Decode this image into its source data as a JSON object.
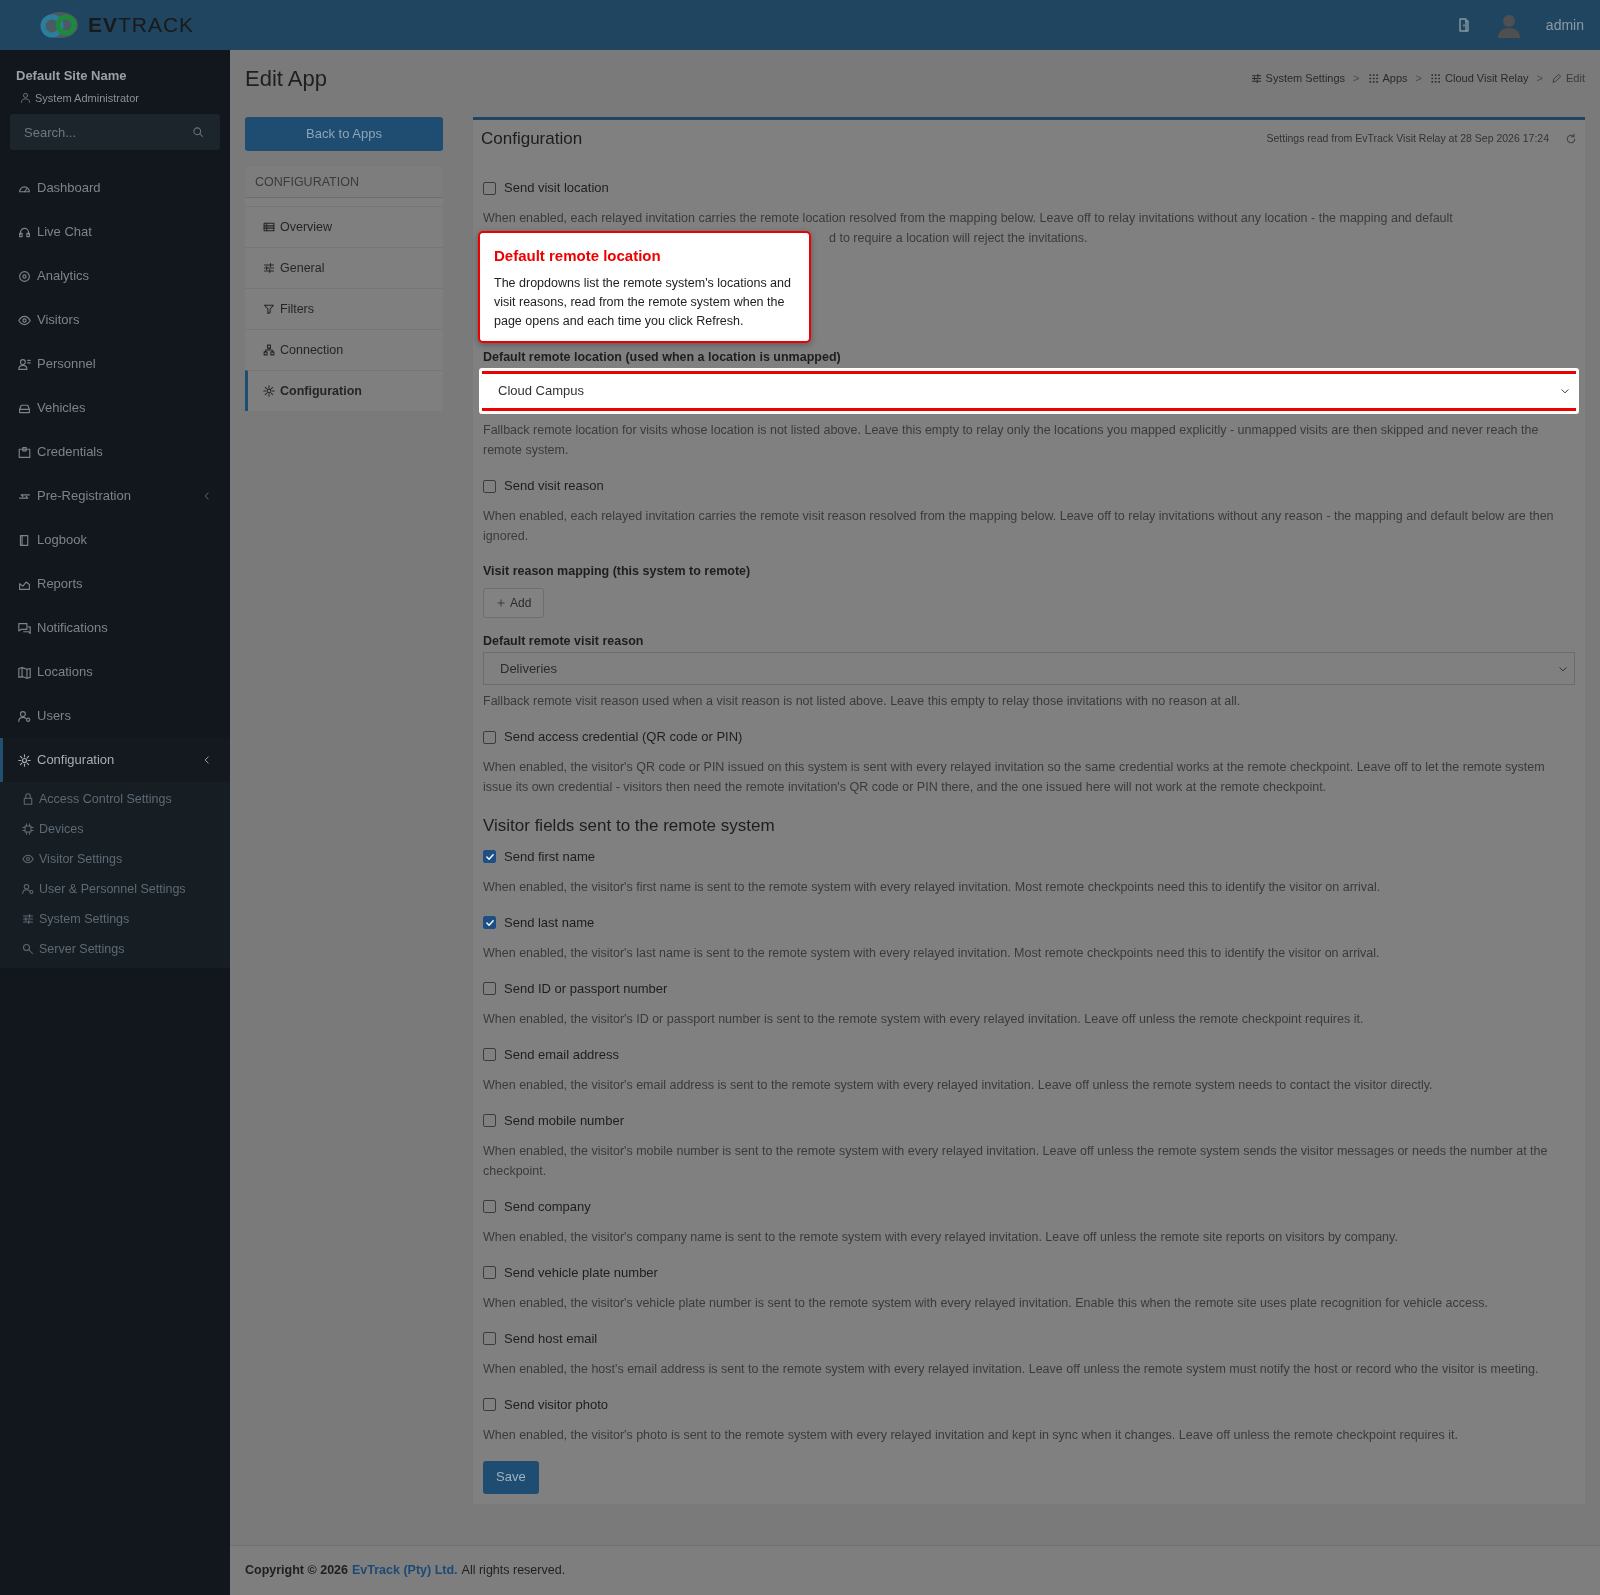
{
  "topbar": {
    "logo": "**EV**TRACK",
    "user": "admin"
  },
  "sidebar": {
    "site_name": "Default Site Name",
    "role": "System Administrator",
    "search": {
      "placeholder": "Search..."
    },
    "items": [
      {
        "label": "Dashboard",
        "selected": false
      },
      {
        "label": "Live Chat",
        "selected": false
      },
      {
        "label": "Analytics",
        "selected": false
      },
      {
        "label": "Visitors",
        "selected": false
      },
      {
        "label": "Personnel",
        "selected": false
      },
      {
        "label": "Vehicles",
        "selected": false
      },
      {
        "label": "Credentials",
        "selected": false
      },
      {
        "label": "Pre-Registration",
        "selected": false,
        "expanded": false
      },
      {
        "label": "Logbook",
        "selected": false
      },
      {
        "label": "Reports",
        "selected": false
      },
      {
        "label": "Notifications",
        "selected": false
      },
      {
        "label": "Locations",
        "selected": false
      },
      {
        "label": "Users",
        "selected": false
      },
      {
        "label": "Configuration",
        "selected": true,
        "expanded": true,
        "children": [
          {
            "label": "Access Control Settings"
          },
          {
            "label": "Devices"
          },
          {
            "label": "Visitor Settings"
          },
          {
            "label": "User & Personnel Settings"
          },
          {
            "label": "System Settings"
          },
          {
            "label": "Server Settings"
          }
        ]
      }
    ]
  },
  "page_title": "Edit App",
  "breadcrumb": [
    {
      "label": "System Settings",
      "separator": ">"
    },
    {
      "label": "Apps",
      "separator": ">"
    },
    {
      "label": "Cloud Visit Relay",
      "separator": ">"
    },
    {
      "label": "Edit"
    }
  ],
  "back_button": "Back to Apps",
  "config_nav": {
    "header": "CONFIGURATION",
    "items": [
      {
        "label": "Overview",
        "selected": false
      },
      {
        "label": "General",
        "selected": false
      },
      {
        "label": "Filters",
        "selected": false
      },
      {
        "label": "Connection",
        "selected": false
      },
      {
        "label": "Configuration",
        "selected": true
      }
    ]
  },
  "card": {
    "title": "Configuration",
    "status": "Settings read from EvTrack Visit Relay at 28 Sep 2026 17:24",
    "fields": [
      {
        "kind": "checkbox",
        "label": "Send visit location",
        "checked": false,
        "description": "When enabled, each relayed invitation carries the remote location resolved from the mapping below. Leave off to relay invitations without any location - the mapping and default",
        "description_tail": "d to require a location will reject the invitations."
      },
      {
        "kind": "select",
        "label": "Default remote location (used when a location is unmapped)",
        "value": "Cloud Campus",
        "highlighted": true,
        "description": "Fallback remote location for visits whose location is not listed above. Leave this empty to relay only the locations you mapped explicitly - unmapped visits are then skipped and never reach the remote system."
      },
      {
        "kind": "checkbox",
        "label": "Send visit reason",
        "checked": false,
        "description": "When enabled, each relayed invitation carries the remote visit reason resolved from the mapping below. Leave off to relay invitations without any reason - the mapping and default below are then ignored."
      },
      {
        "kind": "mapping",
        "label": "Visit reason mapping (this system to remote)",
        "button": "Add"
      },
      {
        "kind": "select",
        "label": "Default remote visit reason",
        "value": "Deliveries",
        "highlighted": false,
        "description": "Fallback remote visit reason used when a visit reason is not listed above. Leave this empty to relay those invitations with no reason at all."
      },
      {
        "kind": "checkbox",
        "label": "Send access credential (QR code or PIN)",
        "checked": false,
        "description": "When enabled, the visitor's QR code or PIN issued on this system is sent with every relayed invitation so the same credential works at the remote checkpoint. Leave off to let the remote system issue its own credential - visitors then need the remote invitation's QR code or PIN there, and the one issued here will not work at the remote checkpoint."
      },
      {
        "kind": "heading",
        "label": "Visitor fields sent to the remote system"
      },
      {
        "kind": "checkbox",
        "label": "Send first name",
        "checked": true,
        "description": "When enabled, the visitor's first name is sent to the remote system with every relayed invitation. Most remote checkpoints need this to identify the visitor on arrival."
      },
      {
        "kind": "checkbox",
        "label": "Send last name",
        "checked": true,
        "description": "When enabled, the visitor's last name is sent to the remote system with every relayed invitation. Most remote checkpoints need this to identify the visitor on arrival."
      },
      {
        "kind": "checkbox",
        "label": "Send ID or passport number",
        "checked": false,
        "description": "When enabled, the visitor's ID or passport number is sent to the remote system with every relayed invitation. Leave off unless the remote checkpoint requires it."
      },
      {
        "kind": "checkbox",
        "label": "Send email address",
        "checked": false,
        "description": "When enabled, the visitor's email address is sent to the remote system with every relayed invitation. Leave off unless the remote system needs to contact the visitor directly."
      },
      {
        "kind": "checkbox",
        "label": "Send mobile number",
        "checked": false,
        "description": "When enabled, the visitor's mobile number is sent to the remote system with every relayed invitation. Leave off unless the remote system sends the visitor messages or needs the number at the checkpoint."
      },
      {
        "kind": "checkbox",
        "label": "Send company",
        "checked": false,
        "description": "When enabled, the visitor's company name is sent to the remote system with every relayed invitation. Leave off unless the remote site reports on visitors by company."
      },
      {
        "kind": "checkbox",
        "label": "Send vehicle plate number",
        "checked": false,
        "description": "When enabled, the visitor's vehicle plate number is sent to the remote system with every relayed invitation. Enable this when the remote site uses plate recognition for vehicle access."
      },
      {
        "kind": "checkbox",
        "label": "Send host email",
        "checked": false,
        "description": "When enabled, the host's email address is sent to the remote system with every relayed invitation. Leave off unless the remote system must notify the host or record who the visitor is meeting."
      },
      {
        "kind": "checkbox",
        "label": "Send visitor photo",
        "checked": false,
        "description": "When enabled, the visitor's photo is sent to the remote system with every relayed invitation and kept in sync when it changes. Leave off unless the remote checkpoint requires it."
      }
    ],
    "save_button": "Save"
  },
  "callout": {
    "title": "Default remote location",
    "text": "The dropdowns list the remote system's locations and visit reasons, read from the remote system when the page opens and each time you click Refresh."
  },
  "footer": {
    "prefix": "Copyright © 2026",
    "link": "EvTrack (Pty) Ltd.",
    "suffix": "All rights reserved."
  }
}
